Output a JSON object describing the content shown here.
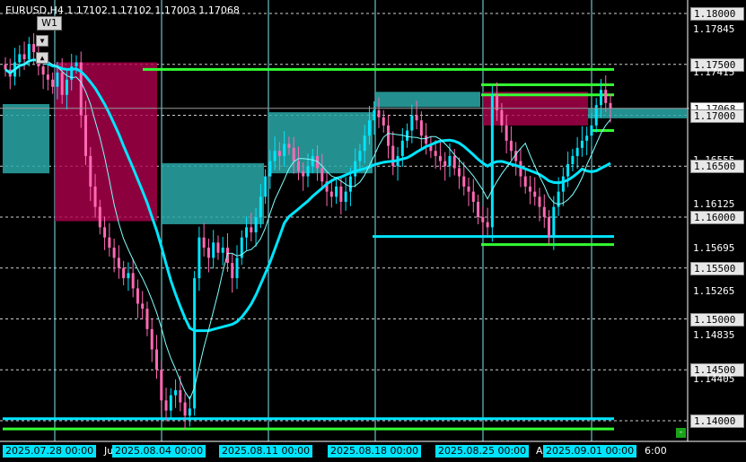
{
  "window": {
    "symbol_line": "EURUSD,H4  1.17102 1.17102 1.17003 1.17068",
    "timeframe_button": "W1",
    "down_arrow": "▼",
    "up_arrow": "▲"
  },
  "price_axis": {
    "labels": [
      {
        "text": "1.18000",
        "style": "boxed",
        "price": 1.18
      },
      {
        "text": "1.17845",
        "style": "plain",
        "price": 1.17845
      },
      {
        "text": "1.17500",
        "style": "boxed",
        "price": 1.175
      },
      {
        "text": "1.17415",
        "style": "plain",
        "price": 1.17415
      },
      {
        "text": "1.17068",
        "style": "current",
        "price": 1.17068
      },
      {
        "text": "1.17000",
        "style": "boxed",
        "price": 1.17
      },
      {
        "text": "1.16555",
        "style": "plain",
        "price": 1.16555
      },
      {
        "text": "1.16500",
        "style": "boxed",
        "price": 1.165
      },
      {
        "text": "1.16125",
        "style": "plain",
        "price": 1.16125
      },
      {
        "text": "1.16000",
        "style": "boxed",
        "price": 1.16
      },
      {
        "text": "1.15695",
        "style": "plain",
        "price": 1.15695
      },
      {
        "text": "1.15500",
        "style": "boxed",
        "price": 1.155
      },
      {
        "text": "1.15265",
        "style": "plain",
        "price": 1.15265
      },
      {
        "text": "1.15000",
        "style": "boxed",
        "price": 1.15
      },
      {
        "text": "1.14835",
        "style": "plain",
        "price": 1.14835
      },
      {
        "text": "1.14500",
        "style": "boxed",
        "price": 1.145
      },
      {
        "text": "1.14405",
        "style": "plain",
        "price": 1.14405
      },
      {
        "text": "1.14000",
        "style": "boxed",
        "price": 1.14
      }
    ]
  },
  "time_axis": {
    "labels": [
      {
        "text": "2025.07.28 00:00",
        "style": "boxed"
      },
      {
        "text": "Ju",
        "style": "plain"
      },
      {
        "text": "2025.08.04 00:00",
        "style": "boxed"
      },
      {
        "text": "2025.08.11 00:00",
        "style": "boxed"
      },
      {
        "text": "2025.08.18 00:00",
        "style": "boxed"
      },
      {
        "text": "2025.08.25 00:00",
        "style": "boxed"
      },
      {
        "text": "A",
        "style": "plain"
      },
      {
        "text": "2025.09.01 00:00",
        "style": "boxed"
      },
      {
        "text": "6:00",
        "style": "plain"
      }
    ]
  },
  "colors": {
    "background": "#000000",
    "bull_candle": "#00e5ff",
    "bear_candle": "#ff69b4",
    "grid_dash": "#ffffff",
    "demand_zone": "#2aa8a8",
    "supply_zone": "#b0004e",
    "level_green": "#33ff33",
    "level_cyan": "#00e5ff",
    "ma_slow": "#00e5ff",
    "ma_fast": "#7fffff"
  },
  "chart_data": {
    "type": "candlestick",
    "symbol": "EURUSD",
    "timeframe": "H4",
    "ohlc_current": {
      "open": 1.17102,
      "high": 1.17102,
      "low": 1.17003,
      "close": 1.17068
    },
    "ylim": [
      1.138,
      1.1825
    ],
    "grid_levels": [
      1.18,
      1.175,
      1.17,
      1.165,
      1.16,
      1.155,
      1.15,
      1.145,
      1.14
    ],
    "period_separators": [
      "2025.07.28 00:00",
      "2025.08.04 00:00",
      "2025.08.11 00:00",
      "2025.08.18 00:00",
      "2025.08.25 00:00",
      "2025.09.01 00:00"
    ],
    "horizontal_levels": [
      {
        "price": 1.1745,
        "color": "green"
      },
      {
        "price": 1.173,
        "color": "green"
      },
      {
        "price": 1.172,
        "color": "green"
      },
      {
        "price": 1.1685,
        "color": "green"
      },
      {
        "price": 1.1581,
        "color": "cyan"
      },
      {
        "price": 1.1573,
        "color": "green"
      },
      {
        "price": 1.1402,
        "color": "cyan"
      },
      {
        "price": 1.1392,
        "color": "green"
      }
    ],
    "zones": [
      {
        "kind": "demand",
        "top": 1.1711,
        "bottom": 1.1643
      },
      {
        "kind": "supply",
        "top": 1.1752,
        "bottom": 1.1596
      },
      {
        "kind": "demand",
        "top": 1.1653,
        "bottom": 1.1593
      },
      {
        "kind": "demand",
        "top": 1.1703,
        "bottom": 1.1643
      },
      {
        "kind": "demand",
        "top": 1.1723,
        "bottom": 1.1708
      },
      {
        "kind": "supply",
        "top": 1.1723,
        "bottom": 1.169
      },
      {
        "kind": "demand",
        "top": 1.1707,
        "bottom": 1.1697
      }
    ],
    "closes": [
      1.1745,
      1.1738,
      1.1752,
      1.176,
      1.1755,
      1.177,
      1.1762,
      1.1748,
      1.174,
      1.1735,
      1.1728,
      1.1742,
      1.172,
      1.1735,
      1.1748,
      1.1752,
      1.17,
      1.166,
      1.163,
      1.161,
      1.159,
      1.158,
      1.157,
      1.156,
      1.155,
      1.154,
      1.1545,
      1.153,
      1.1515,
      1.151,
      1.149,
      1.147,
      1.145,
      1.142,
      1.141,
      1.1425,
      1.143,
      1.1418,
      1.1405,
      1.1412,
      1.154,
      1.158,
      1.157,
      1.156,
      1.1575,
      1.1565,
      1.157,
      1.1555,
      1.154,
      1.156,
      1.158,
      1.159,
      1.1585,
      1.16,
      1.162,
      1.164,
      1.1655,
      1.1665,
      1.166,
      1.1672,
      1.1668,
      1.1655,
      1.1645,
      1.164,
      1.165,
      1.166,
      1.1648,
      1.1635,
      1.1625,
      1.162,
      1.163,
      1.1615,
      1.1625,
      1.164,
      1.1655,
      1.1665,
      1.168,
      1.1695,
      1.1705,
      1.1698,
      1.169,
      1.167,
      1.165,
      1.166,
      1.1675,
      1.1685,
      1.17,
      1.1695,
      1.168,
      1.1672,
      1.1665,
      1.166,
      1.1655,
      1.165,
      1.166,
      1.1648,
      1.164,
      1.163,
      1.1625,
      1.1615,
      1.16,
      1.1595,
      1.159,
      1.172,
      1.1705,
      1.169,
      1.1675,
      1.1665,
      1.1655,
      1.164,
      1.163,
      1.1625,
      1.162,
      1.161,
      1.16,
      1.158,
      1.161,
      1.1625,
      1.164,
      1.1652,
      1.166,
      1.1668,
      1.1675,
      1.168,
      1.169,
      1.171,
      1.1725,
      1.1712,
      1.1707
    ]
  }
}
